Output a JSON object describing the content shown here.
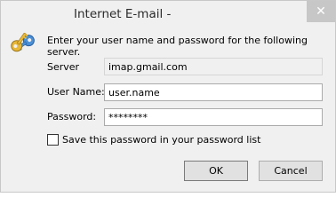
{
  "window": {
    "title": "Internet E-mail -",
    "close_glyph": "✕",
    "accent_close": "#c7c7c7"
  },
  "icon": "keys-icon",
  "prompt": "Enter your user name and password for the following server.",
  "fields": {
    "server_label": "Server",
    "server_value": "imap.gmail.com",
    "username_label": "User Name:",
    "username_value": "user.name",
    "password_label": "Password:",
    "password_value": "********"
  },
  "save_password": {
    "checked": false,
    "label": "Save this password in your password list"
  },
  "buttons": {
    "ok": "OK",
    "cancel": "Cancel"
  }
}
